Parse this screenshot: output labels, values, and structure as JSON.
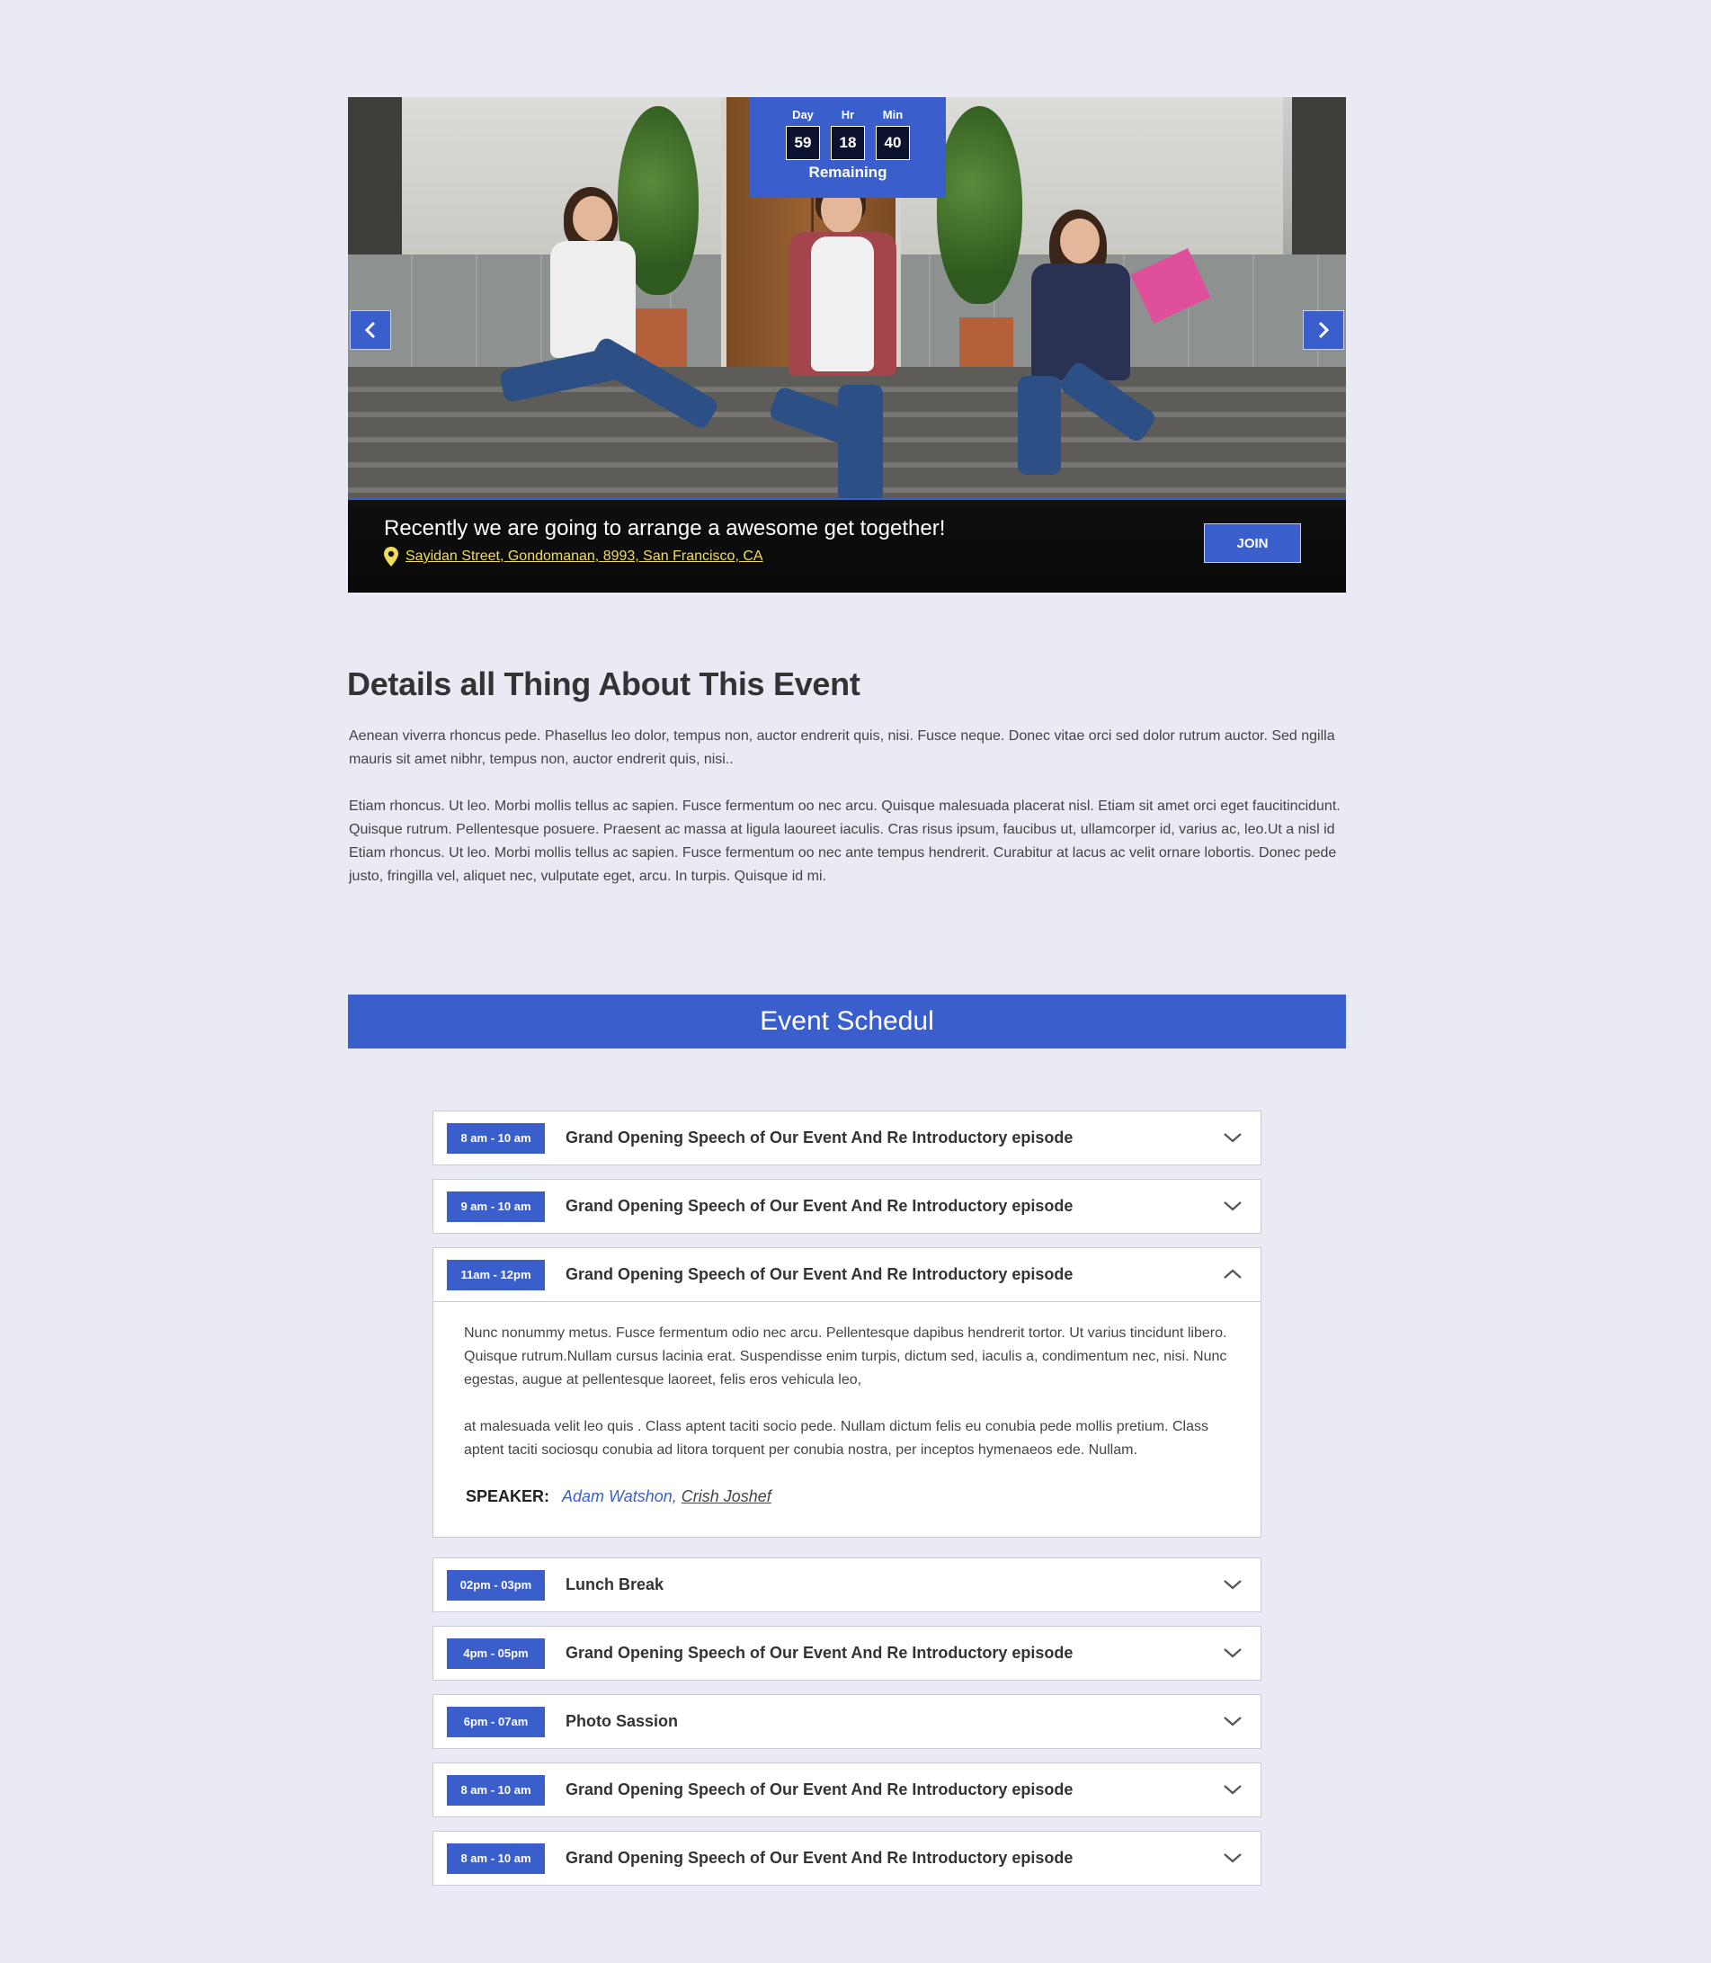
{
  "hero": {
    "countdown": {
      "units": [
        {
          "label": "Day",
          "value": "59"
        },
        {
          "label": "Hr",
          "value": "18"
        },
        {
          "label": "Min",
          "value": "40"
        }
      ],
      "remaining_label": "Remaining"
    },
    "title": "Recently we are going to arrange a awesome get together!",
    "location": "Sayidan Street, Gondomanan, 8993, San Francisco, CA",
    "join_label": "JOIN",
    "prev_icon": "chevron-left-icon",
    "next_icon": "chevron-right-icon",
    "location_icon": "map-pin-icon"
  },
  "details": {
    "heading": "Details all Thing About This Event",
    "paragraphs": [
      "Aenean viverra rhoncus pede. Phasellus leo dolor, tempus non, auctor endrerit quis, nisi. Fusce neque. Donec vitae orci sed dolor rutrum auctor. Sed ngilla mauris sit amet nibhr, tempus non, auctor endrerit quis, nisi..",
      "Etiam rhoncus. Ut leo. Morbi mollis tellus ac sapien. Fusce fermentum oo nec arcu. Quisque malesuada placerat nisl. Etiam sit amet orci eget faucitincidunt. Quisque rutrum. Pellentesque posuere. Praesent ac massa at ligula laoureet iaculis. Cras risus ipsum, faucibus ut, ullamcorper id, varius ac, leo.Ut a nisl id",
      "Etiam rhoncus. Ut leo. Morbi mollis tellus ac sapien. Fusce fermentum oo nec ante tempus hendrerit. Curabitur at lacus ac velit ornare lobortis. Donec pede justo, fringilla vel, aliquet nec, vulputate eget, arcu. In turpis. Quisque id mi."
    ]
  },
  "schedule": {
    "banner": "Event Schedul",
    "items": [
      {
        "time": "8 am - 10 am",
        "title": "Grand Opening Speech of Our Event And Re Introductory episode"
      },
      {
        "time": "9 am - 10 am",
        "title": "Grand Opening Speech of Our Event And Re Introductory episode"
      },
      {
        "time": "11am - 12pm",
        "title": "Grand Opening Speech of Our Event And Re Introductory episode",
        "expanded": true,
        "body": [
          "Nunc nonummy metus. Fusce fermentum odio nec arcu. Pellentesque dapibus hendrerit tortor. Ut varius tincidunt libero. Quisque rutrum.Nullam cursus lacinia erat. Suspendisse enim turpis, dictum sed, iaculis a, condimentum nec, nisi. Nunc egestas, augue at pellentesque laoreet, felis eros vehicula leo,",
          "at malesuada velit leo quis  . Class aptent taciti socio pede. Nullam dictum felis eu conubia  pede mollis pretium. Class aptent taciti sociosqu  conubia  ad litora torquent per conubia nostra, per inceptos hymenaeos ede. Nullam."
        ],
        "speaker_label": "SPEAKER:",
        "speaker_1": "Adam Watshon,",
        "speaker_2": "Crish Joshef"
      },
      {
        "time": "02pm - 03pm",
        "title": "Lunch Break"
      },
      {
        "time": "4pm - 05pm",
        "title": "Grand Opening Speech of Our Event And Re Introductory episode"
      },
      {
        "time": "6pm - 07am",
        "title": "Photo Sassion"
      },
      {
        "time": "8 am - 10 am",
        "title": "Grand Opening Speech of Our Event And Re Introductory episode"
      },
      {
        "time": "8 am - 10 am",
        "title": "Grand Opening Speech of Our Event And Re Introductory episode"
      }
    ]
  },
  "colors": {
    "accent": "#3a5fcd",
    "background": "#e9eaf4",
    "location_link": "#f2dd5a",
    "countdown_box": "#0d1230"
  }
}
